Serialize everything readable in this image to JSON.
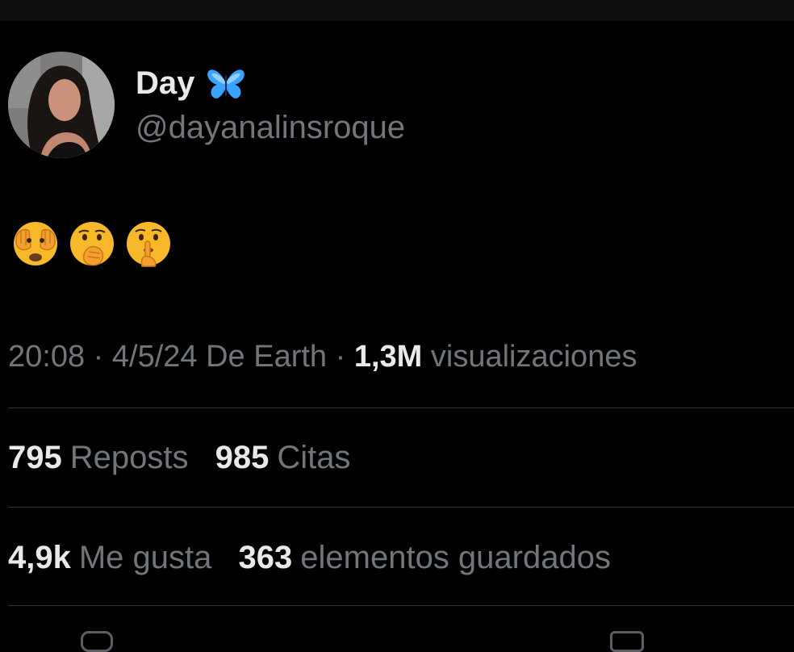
{
  "author": {
    "display_name": "Day",
    "handle": "@dayanalinsroque",
    "badge_icon": "butterfly-icon"
  },
  "tweet": {
    "emojis": [
      "face-with-hands-over-eyes",
      "face-with-hand-over-mouth",
      "shushing-face"
    ]
  },
  "meta": {
    "time": "20:08",
    "date": "4/5/24",
    "location": "De Earth",
    "views_count": "1,3M",
    "views_label": "visualizaciones"
  },
  "stats": {
    "reposts_count": "795",
    "reposts_label": "Reposts",
    "quotes_count": "985",
    "quotes_label": "Citas",
    "likes_count": "4,9k",
    "likes_label": "Me gusta",
    "bookmarks_count": "363",
    "bookmarks_label": "elementos guardados"
  },
  "colors": {
    "background": "#000000",
    "primary_text": "#e7e9ea",
    "secondary_text": "#71767b",
    "divider": "#2f3336",
    "butterfly": "#3aa3ff"
  }
}
